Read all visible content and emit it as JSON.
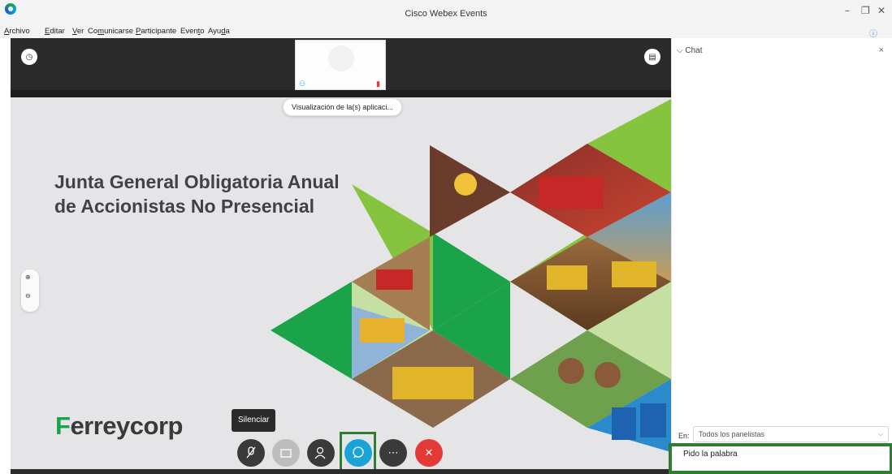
{
  "window": {
    "title": "Cisco Webex Events",
    "minimize": "–",
    "restore": "❐",
    "close": "✕"
  },
  "menu": {
    "items": [
      {
        "label": "Archivo",
        "accel": "A",
        "rest": "rchivo"
      },
      {
        "label": "Editar",
        "accel": "E",
        "rest": "ditar"
      },
      {
        "label": "Ver",
        "accel": "V",
        "rest": "er"
      },
      {
        "label": "Comunicarse",
        "pre": "Co",
        "accel": "m",
        "rest": "unicarse"
      },
      {
        "label": "Participante",
        "accel": "P",
        "rest": "articipante"
      },
      {
        "label": "Evento",
        "pre": "Even",
        "accel": "t",
        "rest": "o"
      },
      {
        "label": "Ayuda",
        "pre": "Ayu",
        "accel": "d",
        "rest": "a"
      }
    ],
    "info_icon": "info-icon"
  },
  "stage": {
    "pill": "Visualización de la(s) aplicaci...",
    "slide": {
      "heading_line1": "Junta General Obligatoria Anual",
      "heading_line2": "de Accionistas No Presencial",
      "logo_text": "erreycorp",
      "brand_green": "#1ba34a",
      "accent_green": "#86c440"
    },
    "zoom_in": "⊕",
    "zoom_out": "⊖"
  },
  "controls": {
    "tooltip": "Silenciar",
    "buttons": [
      {
        "name": "mute-button",
        "icon": "mic-off-icon",
        "color": "#3a3a3a"
      },
      {
        "name": "video-button",
        "icon": "camera-icon",
        "color": "#bdbdbd"
      },
      {
        "name": "participants-button",
        "icon": "participants-icon",
        "color": "#3a3a3a"
      },
      {
        "name": "chat-button",
        "icon": "chat-icon",
        "color": "#1ba3d8"
      },
      {
        "name": "more-button",
        "icon": "more-icon",
        "color": "#3a3a3a"
      },
      {
        "name": "leave-button",
        "icon": "close-icon",
        "color": "#e53935"
      }
    ],
    "highlight_color": "#2e7d32"
  },
  "chat": {
    "title": "Chat",
    "close": "×",
    "to_label": "En:",
    "to_value": "Todos los panelistas",
    "message": "Pido la palabra"
  }
}
